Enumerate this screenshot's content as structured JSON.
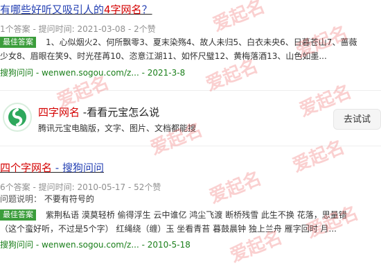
{
  "watermark": "爱起名",
  "result1": {
    "title_prefix": "有哪些好听又吸引人的",
    "title_highlight": "4字网名",
    "title_suffix": "？",
    "meta": "1个答案 - 提问时间: 2021-03-08 - 2个赞",
    "badge": "最佳答案",
    "answer_line1": "1、心似烟火2、何所飘零3、夏末染殇4、故人未归5、白衣未央6、日暮苍山7、蔷薇",
    "answer_line2": "少女8、眉眼在笑9、时光荏苒10、恣意江湖11、如怀尺璧12、黄梅落酒13、山色如墨...",
    "source_site": "搜狗问问 - wenwen.sogou.com/z...",
    "source_date": "- 2021-3-8"
  },
  "card": {
    "title_highlight": "四字网名",
    "title_rest": " -看看元宝怎么说",
    "desc": "腾讯元宝电脑版，文字、图片、文档都能搜",
    "button": "去试试",
    "logo_icon": "yuanbao-logo-icon"
  },
  "result2": {
    "title_highlight": "四个字网名",
    "title_suffix": " - 搜狗问问",
    "meta": "6个答案 - 提问时间: 2010-05-17 - 52个赞",
    "question_label": "问题说明：",
    "question_text": "不要有符号的",
    "badge": "最佳答案",
    "answer_line1": "紫荆私语 漠莫轻桥 偷得浮生 云中谁亿 鸿尘飞渡 断桥残雪 此生不换 花落，思量错",
    "answer_line2": "（这个蛮好听，不过是5个字） 红绳绕（缠）玉 坐看青苔 暮鼓晨钟 独上兰舟 雁字回时 月...",
    "source_site": "搜狗问问 - wenwen.sogou.com/z...",
    "source_date": "- 2010-5-18"
  }
}
